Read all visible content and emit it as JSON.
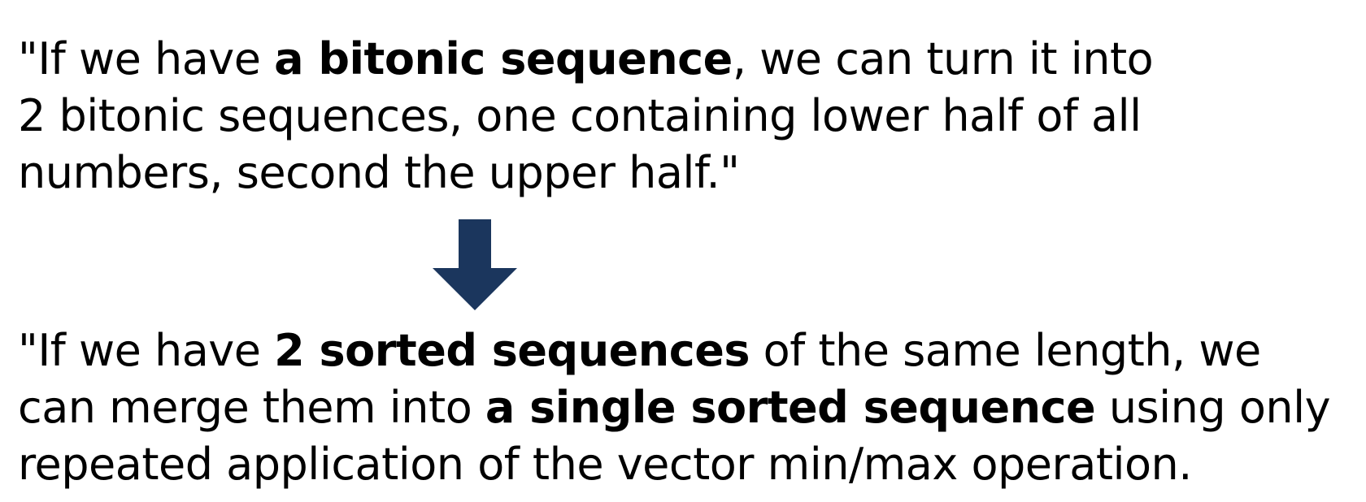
{
  "top_quote": {
    "line1": {
      "pre": "\"If we have ",
      "bold": "a bitonic sequence",
      "post": ", we can turn it into"
    },
    "line2": "2 bitonic sequences, one containing lower half of all",
    "line3": "numbers, second the upper half.\""
  },
  "arrow": {
    "icon": "down-arrow-icon",
    "color": "#1b365d"
  },
  "bottom_quote": {
    "line1": {
      "pre": "\"If we have ",
      "bold": "2 sorted sequences",
      "post": " of the same length, we"
    },
    "line2": {
      "pre": "can merge them into ",
      "bold": "a single sorted sequence",
      "post": " using only"
    },
    "line3": "repeated application of the vector min/max operation."
  }
}
